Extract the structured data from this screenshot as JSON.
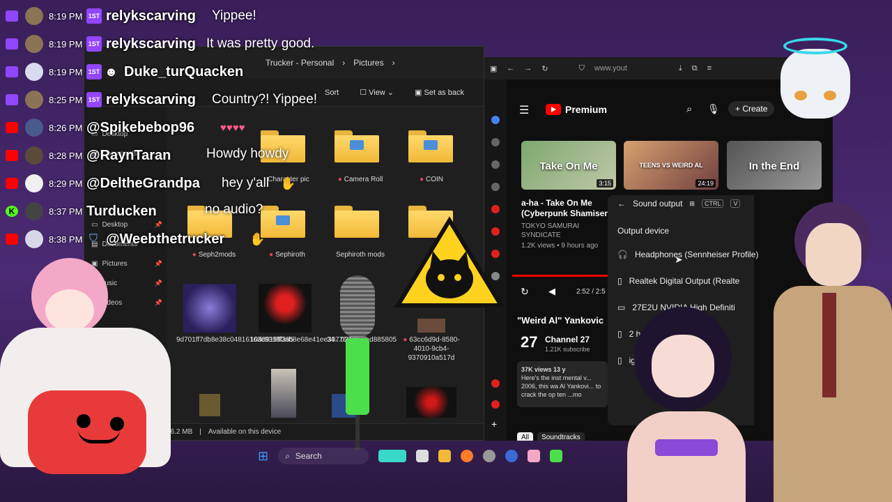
{
  "chat": [
    {
      "platform": "twitch",
      "time": "8:19 PM",
      "badge": "1ST",
      "user": "relykscarving",
      "message": "Yippee!"
    },
    {
      "platform": "twitch",
      "time": "8:19 PM",
      "badge": "1ST",
      "user": "relykscarving",
      "message": "It was pretty good."
    },
    {
      "platform": "twitch",
      "time": "8:19 PM",
      "badge": "1ST",
      "user": "Duke_turQuacken",
      "message": ""
    },
    {
      "platform": "twitch",
      "time": "8:25 PM",
      "badge": "1ST",
      "user": "relykscarving",
      "message": "Country?! Yippee!"
    },
    {
      "platform": "youtube",
      "time": "8:26 PM",
      "badge": "",
      "user": "@Spikebebop96",
      "message": ""
    },
    {
      "platform": "youtube",
      "time": "8:28 PM",
      "badge": "",
      "user": "@RaynTaran",
      "message": "Howdy howdy"
    },
    {
      "platform": "youtube",
      "time": "8:29 PM",
      "badge": "",
      "user": "@DeltheGrandpa",
      "message": "hey y'all"
    },
    {
      "platform": "kick",
      "time": "8:37 PM",
      "badge": "",
      "user": "Turducken",
      "message": "no audio?"
    },
    {
      "platform": "youtube",
      "time": "8:38 PM",
      "badge": "",
      "user": "@Weebthetrucker",
      "message": ""
    }
  ],
  "explorer": {
    "breadcrumb": [
      "Trucker - Personal",
      "Pictures"
    ],
    "toolbar": {
      "sort": "Sort",
      "view": "View",
      "set_background": "Set as back"
    },
    "nav": [
      {
        "label": "Desktop"
      },
      {
        "label": "Documents"
      },
      {
        "label": "Desktop"
      },
      {
        "label": "Documents"
      },
      {
        "label": "Pictures"
      },
      {
        "label": "Music"
      },
      {
        "label": "Videos"
      }
    ],
    "tiles": [
      {
        "label": "Character pic",
        "kind": "folder"
      },
      {
        "label": "Camera Roll",
        "kind": "folder"
      },
      {
        "label": "COIN",
        "kind": "folder"
      },
      {
        "label": "Seph2mods",
        "kind": "folder"
      },
      {
        "label": "Sephiroth",
        "kind": "folder"
      },
      {
        "label": "Sephiroth mods",
        "kind": "folder"
      },
      {
        "label": "9d701ff7db8e38c04816163c9398f395",
        "kind": "image"
      },
      {
        "label": "10d8915ff3ab8e68e41ee397768cf6c9",
        "kind": "image"
      },
      {
        "label": "34...0279...ead885805",
        "kind": "image"
      },
      {
        "label": "63cc6d9d-8580-4010-9cb4-9370910a517d",
        "kind": "image"
      }
    ],
    "status": {
      "size": "26.2 MB",
      "availability": "Available on this device"
    }
  },
  "browser": {
    "url": "www.yout",
    "youtube": {
      "logo": "Premium",
      "create": "Create",
      "thumbs": [
        {
          "text": "Take On Me",
          "duration": "3:15"
        },
        {
          "text": "TEENS VS WEIRD AL",
          "duration": "24:19"
        },
        {
          "text": "In the End",
          "duration": ""
        }
      ],
      "video_title": "a-ha - Take On Me (Cyberpunk Shamisen",
      "channel": "TOKYO SAMURAI SYNDICATE",
      "meta": "1.2K views • 9 hours ago",
      "player_time": "2:52 / 2:5",
      "second_title": "\"Weird Al\" Yankovic",
      "second_channel": "Channel 27",
      "second_subs": "1.21K subscribe",
      "second_meta": "37K views  13 y",
      "desc": "Here's the inst  mental v... 2006, this wa  Al Yankovi... to crack the  op ten ...mo",
      "chips": [
        "All",
        "Soundtracks"
      ]
    }
  },
  "sound_flyout": {
    "title": "Sound output",
    "shortcut": [
      "CTRL",
      "V"
    ],
    "section": "Output device",
    "devices": [
      {
        "label": "Headphones (Sennheiser Profile)",
        "selected": true
      },
      {
        "label": "Realtek Digital Output (Realte",
        "selected": false
      },
      {
        "label": "27E2U  NVIDIA High Definiti",
        "selected": false
      },
      {
        "label": "2   h Defi",
        "selected": false
      },
      {
        "label": "   igh D",
        "selected": false
      }
    ]
  },
  "taskbar": {
    "search": "Search"
  },
  "colors": {
    "twitch": "#9146ff",
    "youtube": "#ff0000",
    "kick": "#53fc18",
    "folder": "#f2b938"
  }
}
